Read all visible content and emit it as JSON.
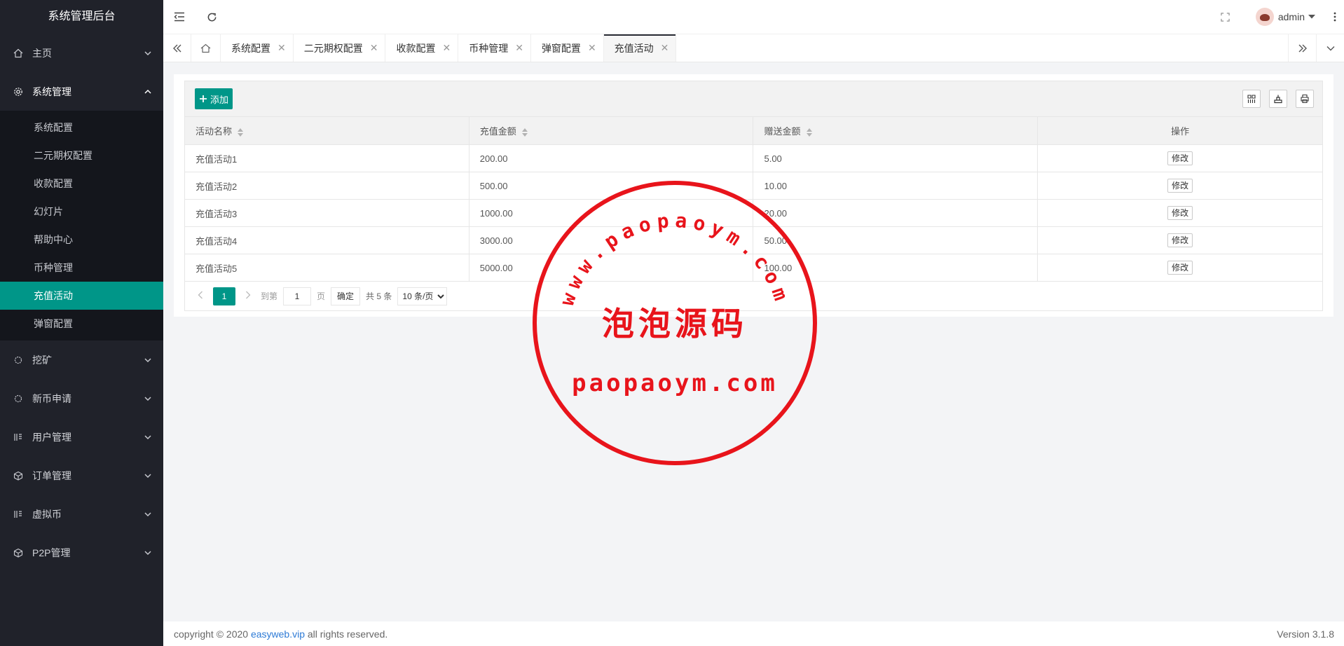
{
  "sidebar": {
    "title": "系统管理后台",
    "items": [
      {
        "label": "主页"
      },
      {
        "label": "系统管理",
        "children": [
          "系统配置",
          "二元期权配置",
          "收款配置",
          "幻灯片",
          "帮助中心",
          "币种管理",
          "充值活动",
          "弹窗配置"
        ]
      },
      {
        "label": "挖矿"
      },
      {
        "label": "新币申请"
      },
      {
        "label": "用户管理"
      },
      {
        "label": "订单管理"
      },
      {
        "label": "虚拟币"
      },
      {
        "label": "P2P管理"
      }
    ]
  },
  "header": {
    "user": "admin"
  },
  "tabs": [
    "系统配置",
    "二元期权配置",
    "收款配置",
    "币种管理",
    "弹窗配置",
    "充值活动"
  ],
  "toolbar": {
    "add_label": "添加"
  },
  "table": {
    "columns": [
      "活动名称",
      "充值金额",
      "赠送金额",
      "操作"
    ],
    "rows": [
      {
        "name": "充值活动1",
        "amount": "200.00",
        "bonus": "5.00",
        "action": "修改"
      },
      {
        "name": "充值活动2",
        "amount": "500.00",
        "bonus": "10.00",
        "action": "修改"
      },
      {
        "name": "充值活动3",
        "amount": "1000.00",
        "bonus": "20.00",
        "action": "修改"
      },
      {
        "name": "充值活动4",
        "amount": "3000.00",
        "bonus": "50.00",
        "action": "修改"
      },
      {
        "name": "充值活动5",
        "amount": "5000.00",
        "bonus": "100.00",
        "action": "修改"
      }
    ]
  },
  "pager": {
    "current": "1",
    "goto_label": "到第",
    "goto_value": "1",
    "page_label": "页",
    "ok_label": "确定",
    "total": "共 5 条",
    "page_size": "10 条/页"
  },
  "footer": {
    "prefix": "copyright © 2020",
    "link": "easyweb.vip",
    "suffix": "all rights reserved.",
    "version": "Version 3.1.8"
  },
  "watermark": {
    "url_arc": "www.paopaoym.com",
    "cn": "泡泡源码",
    "en": "paopaoym.com"
  },
  "colors": {
    "accent": "#009688",
    "sidebar": "#20222a",
    "stamp": "#e8141b"
  }
}
